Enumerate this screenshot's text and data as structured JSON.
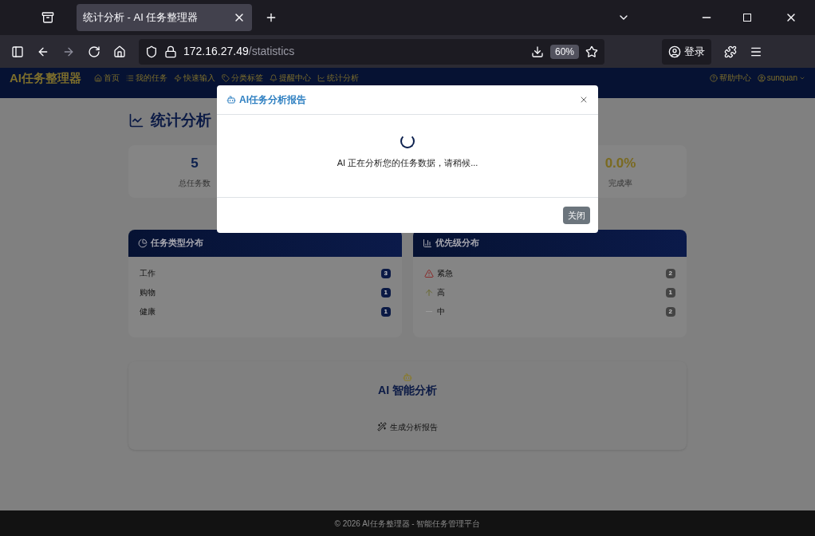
{
  "browser": {
    "tab_title": "统计分析 - AI 任务整理器",
    "url_host": "172.16.27.49",
    "url_path": "/statistics",
    "zoom": "60%",
    "login": "登录"
  },
  "nav": {
    "brand": "AI任务整理器",
    "items": [
      {
        "label": "首页"
      },
      {
        "label": "我的任务"
      },
      {
        "label": "快速输入"
      },
      {
        "label": "分类标签"
      },
      {
        "label": "提醒中心"
      },
      {
        "label": "统计分析"
      }
    ],
    "help": "帮助中心",
    "user": "sunquan"
  },
  "page_title": "统计分析",
  "stats": [
    {
      "value": "5",
      "label": "总任务数",
      "color": "#0b1f4d"
    },
    {
      "value": "0.0%",
      "label": "完成率",
      "color": "#7a6a20"
    }
  ],
  "panels": [
    {
      "title": "任务类型分布",
      "rows": [
        {
          "label": "工作",
          "count": "3",
          "kind": "plain"
        },
        {
          "label": "购物",
          "count": "1",
          "kind": "plain"
        },
        {
          "label": "健康",
          "count": "1",
          "kind": "plain"
        }
      ]
    },
    {
      "title": "优先级分布",
      "rows": [
        {
          "label": "紧急",
          "count": "2",
          "kind": "urgent"
        },
        {
          "label": "高",
          "count": "1",
          "kind": "high"
        },
        {
          "label": "中",
          "count": "2",
          "kind": "medium"
        }
      ]
    }
  ],
  "ai": {
    "title": "AI 智能分析",
    "button": "生成分析报告"
  },
  "footer": "© 2026 AI任务整理器 - 智能任务管理平台",
  "modal": {
    "title": "AI任务分析报告",
    "message": "AI 正在分析您的任务数据，请稍候...",
    "close_button": "关闭"
  }
}
